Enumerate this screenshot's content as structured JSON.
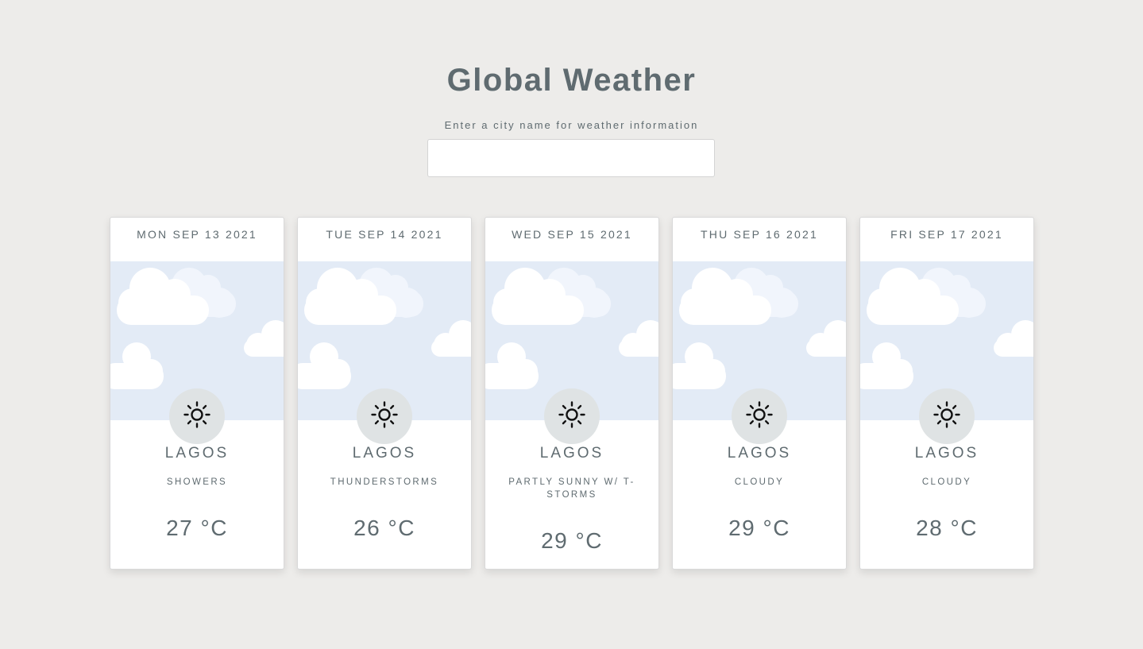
{
  "header": {
    "title": "Global Weather",
    "prompt": "Enter a city name for weather information"
  },
  "search": {
    "value": "",
    "placeholder": ""
  },
  "colors": {
    "background": "#edecea",
    "text": "#5f6b70",
    "sky": "#e3ebf6",
    "icon_circle": "#dfe3e4"
  },
  "forecast": [
    {
      "date": "MON SEP 13 2021",
      "city": "LAGOS",
      "condition": "SHOWERS",
      "temperature": "27 °C",
      "icon": "sun-icon"
    },
    {
      "date": "TUE SEP 14 2021",
      "city": "LAGOS",
      "condition": "THUNDERSTORMS",
      "temperature": "26 °C",
      "icon": "sun-icon"
    },
    {
      "date": "WED SEP 15 2021",
      "city": "LAGOS",
      "condition": "PARTLY SUNNY W/ T-STORMS",
      "temperature": "29 °C",
      "icon": "sun-icon"
    },
    {
      "date": "THU SEP 16 2021",
      "city": "LAGOS",
      "condition": "CLOUDY",
      "temperature": "29 °C",
      "icon": "sun-icon"
    },
    {
      "date": "FRI SEP 17 2021",
      "city": "LAGOS",
      "condition": "CLOUDY",
      "temperature": "28 °C",
      "icon": "sun-icon"
    }
  ]
}
